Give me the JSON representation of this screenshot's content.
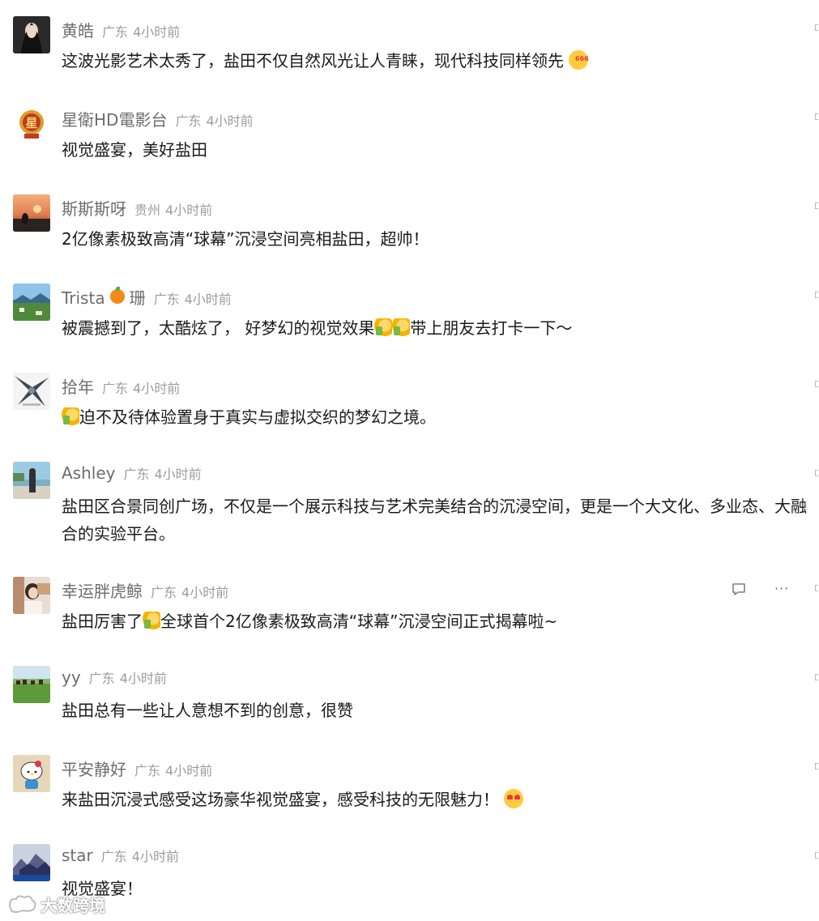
{
  "comments": [
    {
      "name": "黄皓",
      "name_suffix": "",
      "region": "广东",
      "time": "4小时前",
      "text": "这波光影艺术太秀了，盐田不仅自然风光让人青睐，现代科技同样领先",
      "emoji_end": "think-666"
    },
    {
      "name": "星衛HD電影台",
      "name_suffix": "",
      "region": "广东",
      "time": "4小时前",
      "text": "视觉盛宴，美好盐田"
    },
    {
      "name": "斯斯斯呀",
      "name_suffix": "",
      "region": "贵州",
      "time": "4小时前",
      "text": "2亿像素极致高清“球幕”沉浸空间亮相盐田，超帅！"
    },
    {
      "name": "Trista",
      "name_suffix": "珊",
      "region": "广东",
      "time": "4小时前",
      "text_before": "被震撼到了，太酷炫了， 好梦幻的视觉效果",
      "text_after": "带上朋友去打卡一下～"
    },
    {
      "name": "拾年",
      "name_suffix": "",
      "region": "广东",
      "time": "4小时前",
      "text": "迫不及待体验置身于真实与虚拟交织的梦幻之境。"
    },
    {
      "name": "Ashley",
      "name_suffix": "",
      "region": "广东",
      "time": "4小时前",
      "text": "盐田区合景同创广场，不仅是一个展示科技与艺术完美结合的沉浸空间，更是一个大文化、多业态、大融合的实验平台。"
    },
    {
      "name": "幸运胖虎鲸",
      "name_suffix": "",
      "region": "广东",
      "time": "4小时前",
      "text_before": "盐田厉害了",
      "text_after": "全球首个2亿像素极致高清“球幕”沉浸空间正式揭幕啦~",
      "more_label": "···"
    },
    {
      "name": "yy",
      "name_suffix": "",
      "region": "广东",
      "time": "4小时前",
      "text": "盐田总有一些让人意想不到的创意，很赞"
    },
    {
      "name": "平安静好",
      "name_suffix": "",
      "region": "广东",
      "time": "4小时前",
      "text": "来盐田沉浸式感受这场豪华视觉盛宴，感受科技的无限魅力！"
    },
    {
      "name": "star",
      "name_suffix": "",
      "region": "广东",
      "time": "4小时前",
      "text": "视觉盛宴！"
    }
  ],
  "watermark": "大数跨境",
  "colors": {
    "name": "#6d6d6d",
    "meta": "#9c9c9c",
    "text": "#1a1a1a",
    "background": "#ffffff"
  }
}
